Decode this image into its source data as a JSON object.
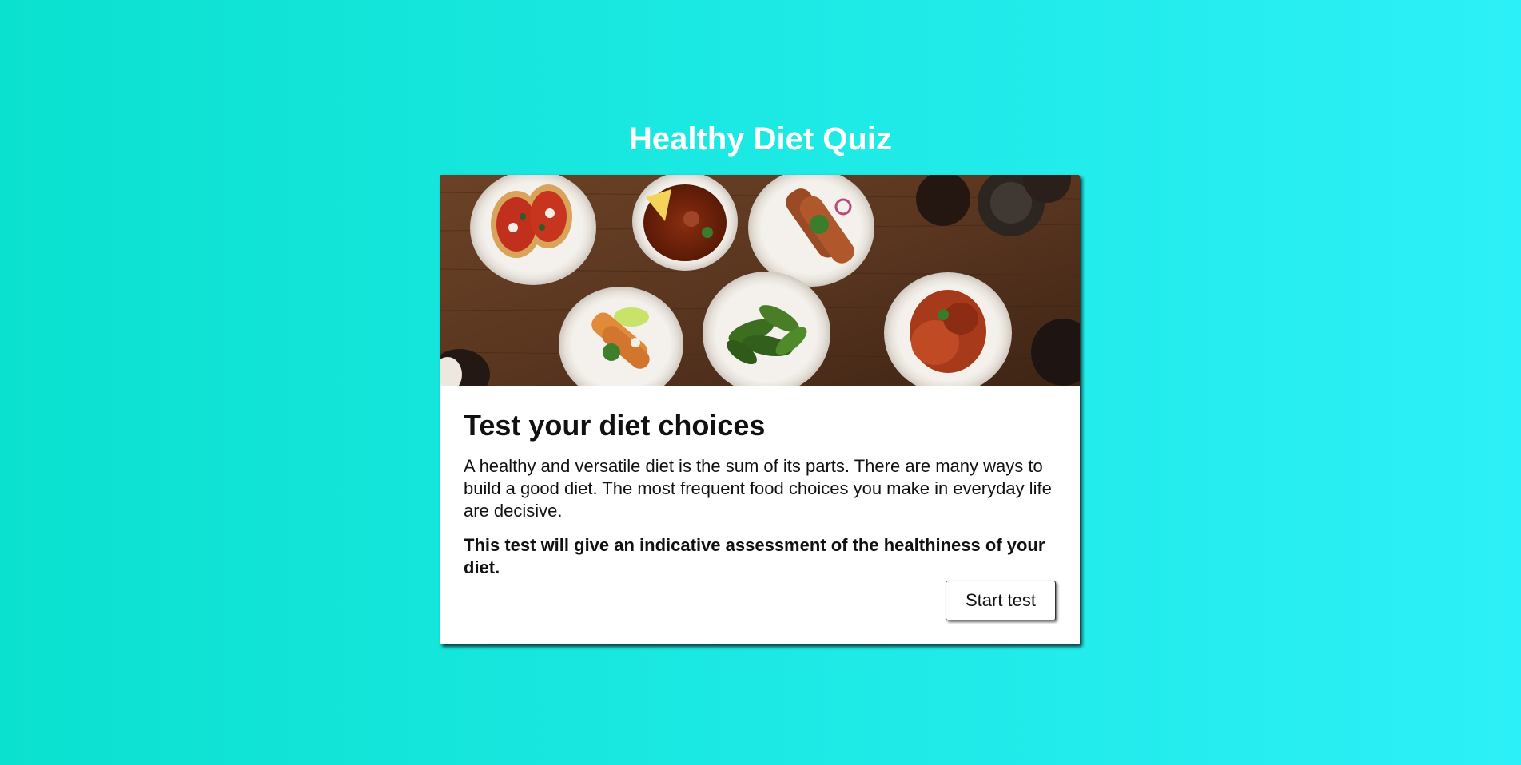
{
  "page": {
    "title": "Healthy Diet Quiz",
    "background_colors": [
      "#0be1cf",
      "#2cf0f7"
    ]
  },
  "card": {
    "hero_image": {
      "description": "food-plates-on-wooden-table"
    },
    "heading": "Test your diet choices",
    "intro": "A healthy and versatile diet is the sum of its parts. There are many ways to build a good diet. The most frequent food choices you make in everyday life are decisive.",
    "emphasis": "This test will give an indicative assessment of the healthiness of your diet.",
    "start_button_label": "Start test"
  }
}
